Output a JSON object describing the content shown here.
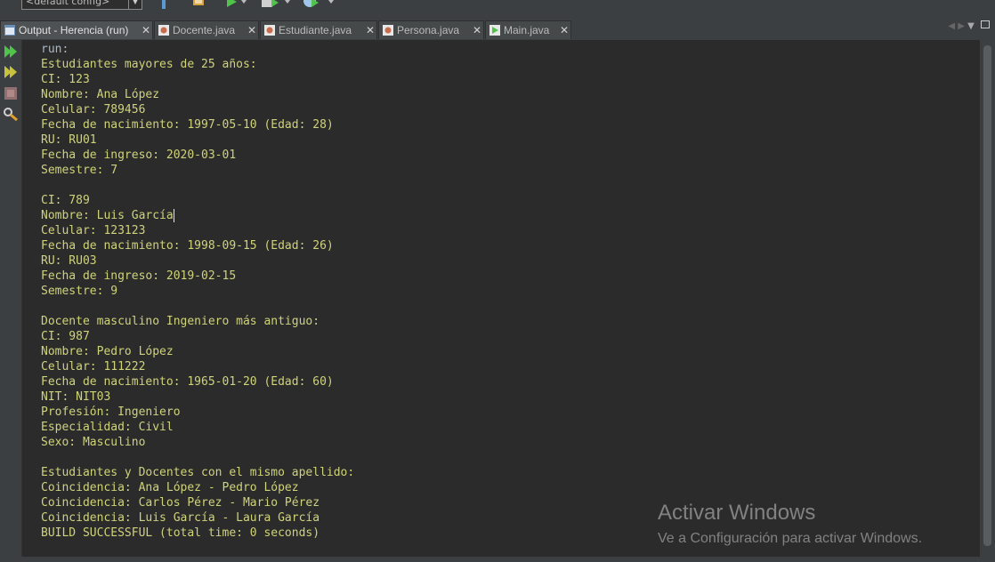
{
  "toolbar": {
    "config_value": "<default config>"
  },
  "tabs": [
    {
      "label": "Output - Herencia (run)",
      "icon": "output-window-icon",
      "active": true
    },
    {
      "label": "Docente.java",
      "icon": "java-class-icon"
    },
    {
      "label": "Estudiante.java",
      "icon": "java-class-icon"
    },
    {
      "label": "Persona.java",
      "icon": "java-class-icon"
    },
    {
      "label": "Main.java",
      "icon": "java-main-class-icon"
    }
  ],
  "tab_close_glyph": "✕",
  "gutter_icons": [
    "rerun-icon",
    "rerun-with-options-icon",
    "stop-icon",
    "settings-icon"
  ],
  "console": {
    "lines": [
      "run:",
      "Estudiantes mayores de 25 años:",
      "CI: 123",
      "Nombre: Ana López",
      "Celular: 789456",
      "Fecha de nacimiento: 1997-05-10 (Edad: 28)",
      "RU: RU01",
      "Fecha de ingreso: 2020-03-01",
      "Semestre: 7",
      "",
      "CI: 789",
      "Nombre: Luis García",
      "Celular: 123123",
      "Fecha de nacimiento: 1998-09-15 (Edad: 26)",
      "RU: RU03",
      "Fecha de ingreso: 2019-02-15",
      "Semestre: 9",
      "",
      "Docente masculino Ingeniero más antiguo:",
      "CI: 987",
      "Nombre: Pedro López",
      "Celular: 111222",
      "Fecha de nacimiento: 1965-01-20 (Edad: 60)",
      "NIT: NIT03",
      "Profesión: Ingeniero",
      "Especialidad: Civil",
      "Sexo: Masculino",
      "",
      "Estudiantes y Docentes con el mismo apellido:",
      "Coincidencia: Ana López - Pedro López",
      "Coincidencia: Carlos Pérez - Mario Pérez",
      "Coincidencia: Luis García - Laura García",
      "BUILD SUCCESSFUL (total time: 0 seconds)"
    ]
  },
  "watermark": {
    "title": "Activar Windows",
    "subtitle": "Ve a Configuración para activar Windows."
  },
  "colors": {
    "output_text": "#cfd37a",
    "background": "#2b2b2b",
    "toolbar": "#3c3f41",
    "run_green": "#4fc34a"
  }
}
